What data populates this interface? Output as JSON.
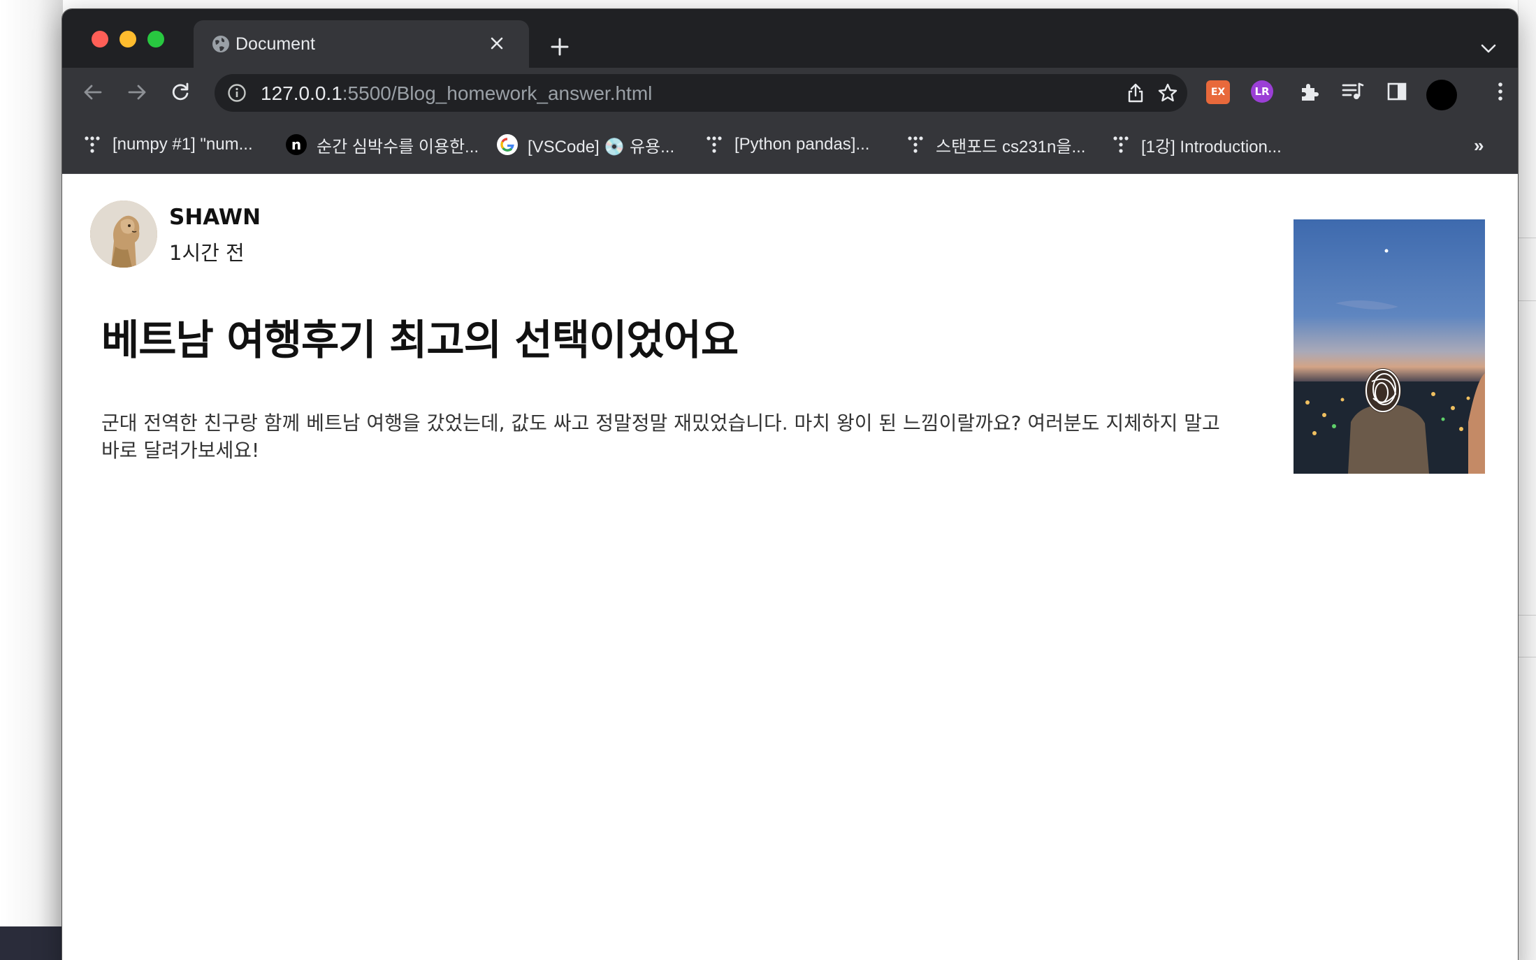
{
  "browser": {
    "tab": {
      "title": "Document"
    },
    "url": {
      "host": "127.0.0.1",
      "rest": ":5500/Blog_homework_answer.html"
    },
    "extensions": {
      "ex_label": "EX",
      "lr_label": "LR"
    },
    "bookmarks": [
      {
        "label": "[numpy #1] \"num...",
        "icon": "dots-icon"
      },
      {
        "label": "순간 심박수를 이용한...",
        "icon": "n-logo-icon"
      },
      {
        "label": "[VSCode] 💿 유용...",
        "icon": "google-icon"
      },
      {
        "label": "[Python pandas]...",
        "icon": "dots-icon"
      },
      {
        "label": "스탠포드 cs231n을...",
        "icon": "dots-icon"
      },
      {
        "label": "[1강] Introduction...",
        "icon": "dots-icon"
      }
    ],
    "bookmarks_more": "»"
  },
  "post": {
    "author": "SHAWN",
    "time_ago": "1시간 전",
    "title": "베트남 여행후기 최고의 선택이었어요",
    "body": "군대 전역한 친구랑 함께 베트남 여행을 갔었는데, 값도 싸고 정말정말 재밌었습니다. 마치 왕이 된 느낌이랄까요? 여러분도 지체하지 말고 바로 달려가보세요!"
  }
}
